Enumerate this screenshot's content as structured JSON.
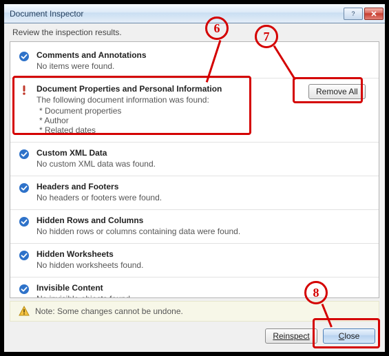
{
  "window": {
    "title": "Document Inspector",
    "help_tooltip": "?",
    "close_tooltip": "✕"
  },
  "instruction": "Review the inspection results.",
  "sections": [
    {
      "status": "ok",
      "title": "Comments and Annotations",
      "text": "No items were found."
    },
    {
      "status": "warn",
      "title": "Document Properties and Personal Information",
      "text": "The following document information was found:",
      "items": [
        "* Document properties",
        "* Author",
        "* Related dates"
      ],
      "action": "Remove All"
    },
    {
      "status": "ok",
      "title": "Custom XML Data",
      "text": "No custom XML data was found."
    },
    {
      "status": "ok",
      "title": "Headers and Footers",
      "text": "No headers or footers were found."
    },
    {
      "status": "ok",
      "title": "Hidden Rows and Columns",
      "text": "No hidden rows or columns containing data were found."
    },
    {
      "status": "ok",
      "title": "Hidden Worksheets",
      "text": "No hidden worksheets found."
    },
    {
      "status": "ok",
      "title": "Invisible Content",
      "text": "No invisible objects found."
    }
  ],
  "note": "Note: Some changes cannot be undone.",
  "buttons": {
    "reinspect": "Reinspect",
    "close_prefix": "C",
    "close_rest": "lose"
  },
  "annotations": {
    "c6": "6",
    "c7": "7",
    "c8": "8"
  }
}
